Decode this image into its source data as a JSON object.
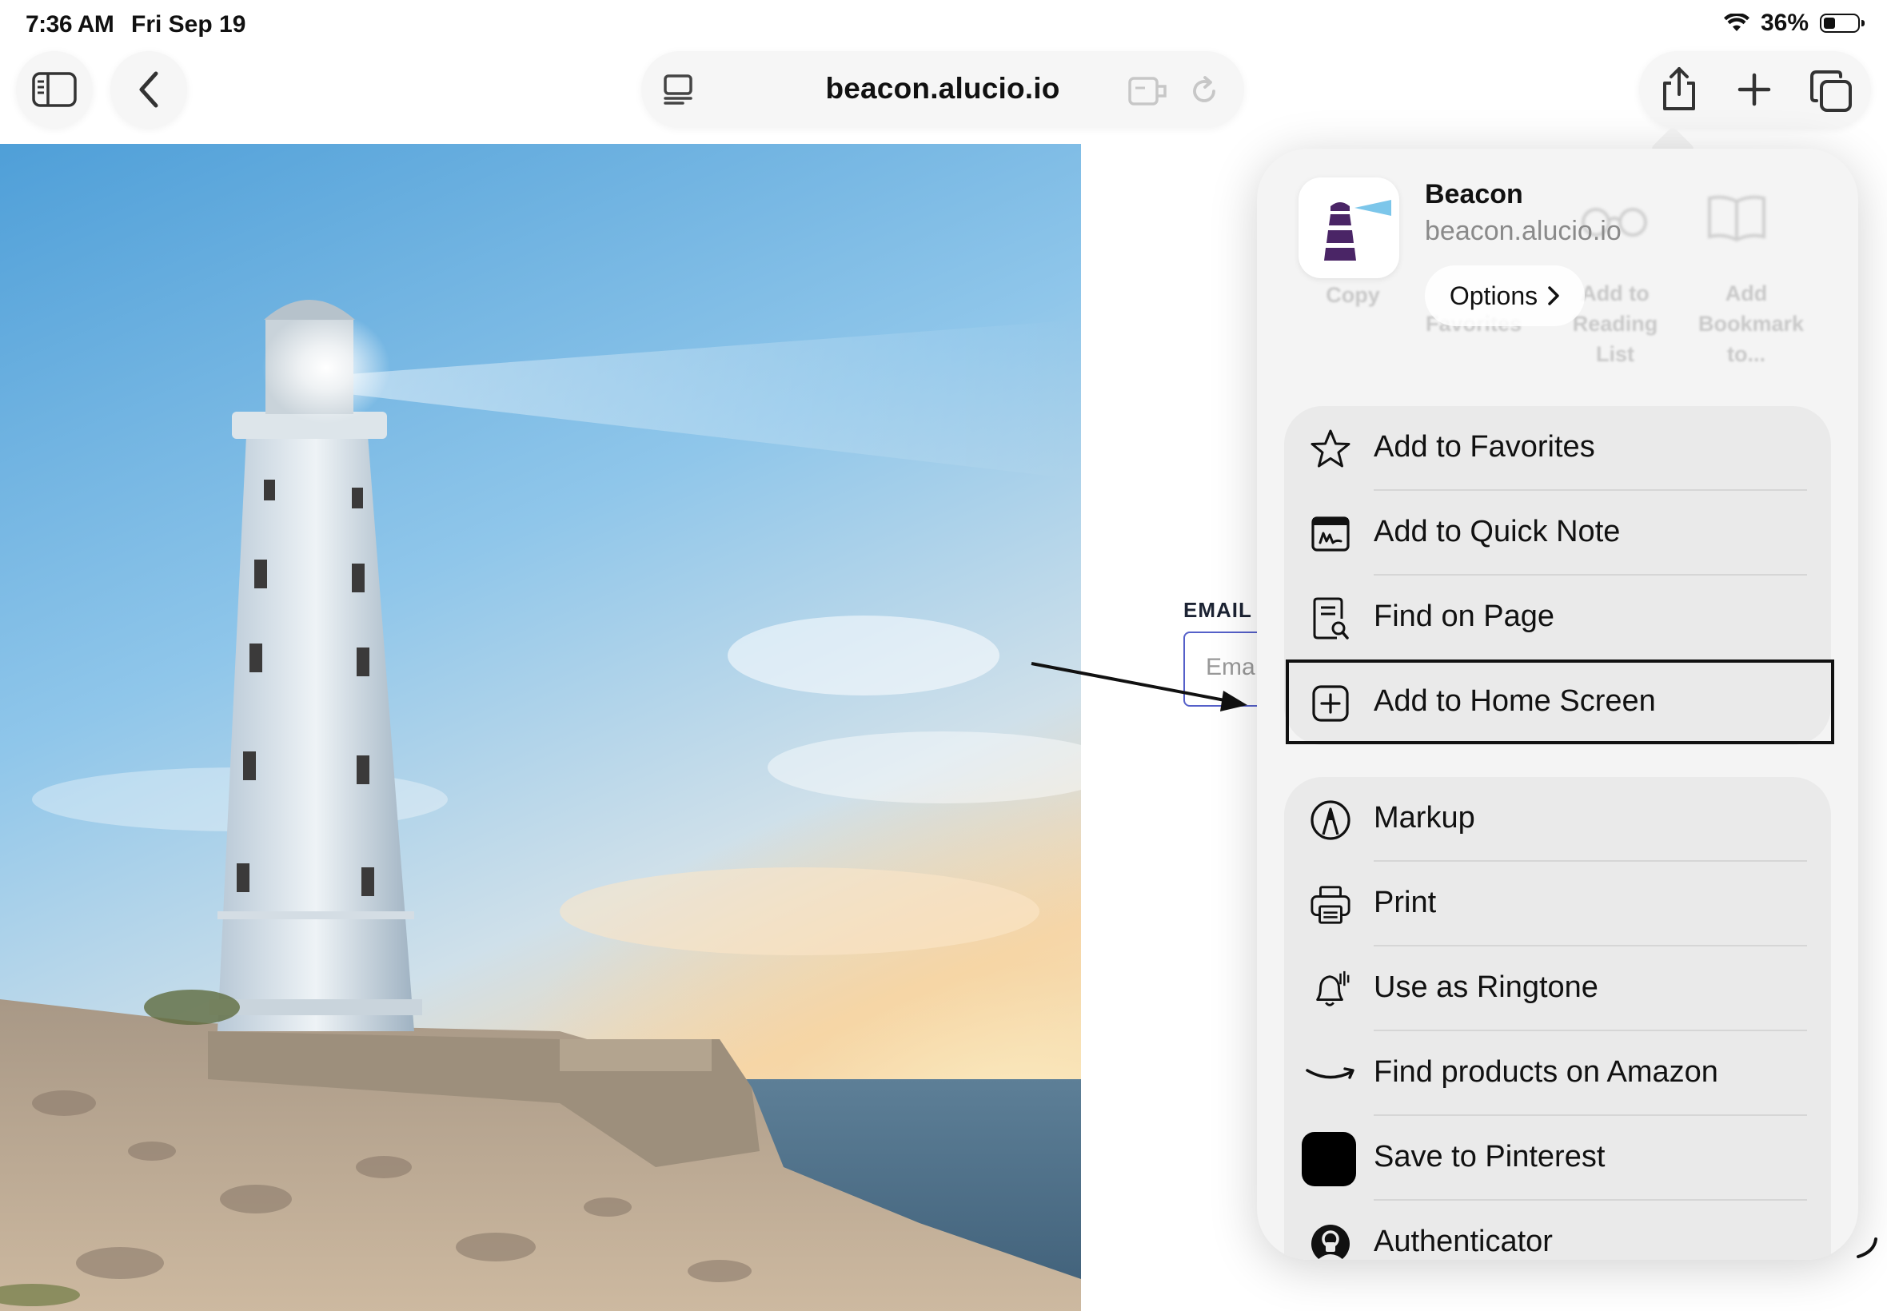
{
  "status_bar": {
    "time": "7:36 AM",
    "date": "Fri Sep 19",
    "battery_percent": "36%",
    "battery_level": 0.36
  },
  "toolbar": {
    "url": "beacon.alucio.io"
  },
  "form": {
    "email_label": "EMAIL",
    "email_placeholder": "Ema"
  },
  "share_sheet": {
    "app_name": "Beacon",
    "app_url": "beacon.alucio.io",
    "options_label": "Options",
    "background_actions": [
      {
        "label": "Copy",
        "icon": "copy-icon"
      },
      {
        "label": "Favorites",
        "icon": "favorites-icon"
      },
      {
        "label": "Add to Reading List",
        "icon": "glasses-icon"
      },
      {
        "label": "Add Bookmark to...",
        "icon": "book-icon"
      }
    ],
    "group1": [
      {
        "label": "Add to Favorites",
        "icon": "star-icon"
      },
      {
        "label": "Add to Quick Note",
        "icon": "quick-note-icon"
      },
      {
        "label": "Find on Page",
        "icon": "find-on-page-icon"
      },
      {
        "label": "Add to Home Screen",
        "icon": "add-square-icon"
      }
    ],
    "group2": [
      {
        "label": "Markup",
        "icon": "markup-icon"
      },
      {
        "label": "Print",
        "icon": "printer-icon"
      },
      {
        "label": "Use as Ringtone",
        "icon": "bell-icon"
      },
      {
        "label": "Find products on Amazon",
        "icon": "amazon-icon"
      },
      {
        "label": "Save to Pinterest",
        "icon": "pinterest-icon"
      },
      {
        "label": "Authenticator",
        "icon": "authenticator-icon"
      }
    ]
  },
  "colors": {
    "sheet_background": "#f4f4f4",
    "group_background": "#eaeaea",
    "lighthouse_brand": "#4a2566",
    "beam": "#7cc6ea",
    "input_border": "#5560c9"
  }
}
